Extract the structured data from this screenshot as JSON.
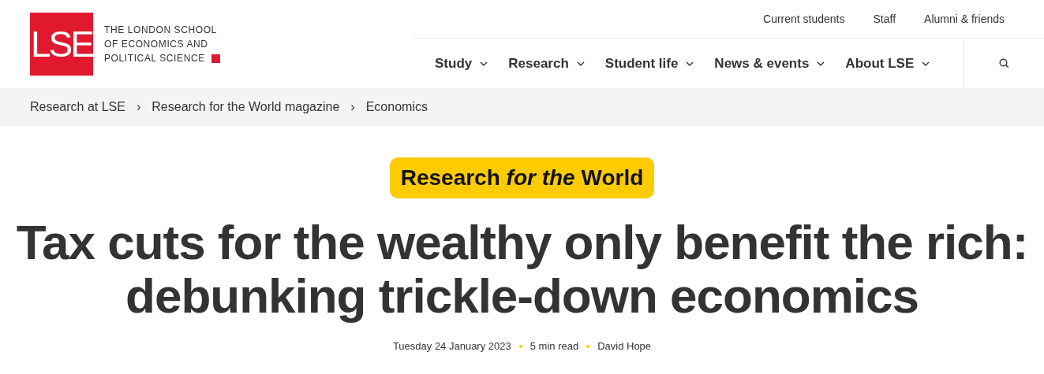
{
  "logo": {
    "mark": "LSE",
    "lines": [
      "THE LONDON SCHOOL",
      "OF ECONOMICS AND",
      "POLITICAL SCIENCE"
    ]
  },
  "utility_nav": [
    "Current students",
    "Staff",
    "Alumni & friends"
  ],
  "main_nav": [
    {
      "label": "Study",
      "expanded": false
    },
    {
      "label": "Research",
      "expanded": false
    },
    {
      "label": "Student life",
      "expanded": false
    },
    {
      "label": "News & events",
      "expanded": false
    },
    {
      "label": "About LSE",
      "expanded": false
    }
  ],
  "breadcrumb": {
    "items": [
      "Research at LSE",
      "Research for the World magazine",
      "Economics"
    ],
    "separator": "›"
  },
  "badge": "Research *for the* World",
  "headline": [
    "Tax cuts for the wealthy only benefit the rich:",
    "debunking trickle-down economics"
  ],
  "meta": [
    "Tuesday 24 January 2023",
    "5 min read",
    "David Hope"
  ]
}
